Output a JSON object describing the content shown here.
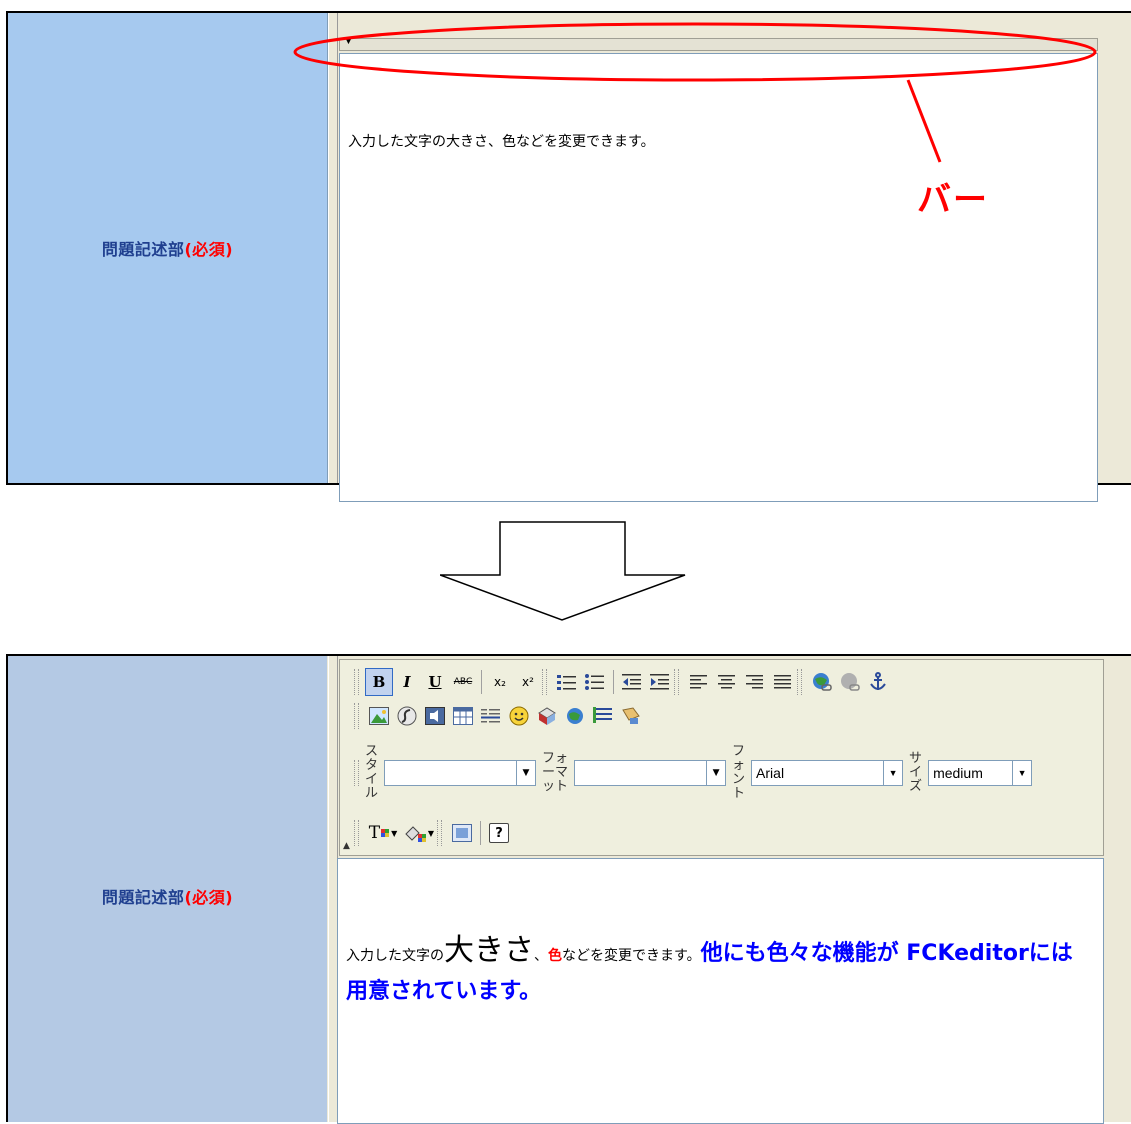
{
  "top_panel": {
    "field_label": "問題記述部",
    "field_required": "(必須)",
    "editor_text": "入力した文字の大きさ、色などを変更できます。",
    "bar_toggle": "▼",
    "callout_label": "バー"
  },
  "bottom_panel": {
    "field_label": "問題記述部",
    "field_required": "(必須)",
    "toolbar": {
      "bold": "B",
      "italic": "I",
      "underline": "U",
      "strike": "ABC",
      "subscript": "x₂",
      "superscript": "x²",
      "style_label": [
        "ス",
        "タ",
        "イ",
        "ル"
      ],
      "style_value": "",
      "format_label": [
        "フォ",
        "ーマ",
        "ット"
      ],
      "format_value": "",
      "font_label": [
        "フ",
        "ォ",
        "ン",
        "ト"
      ],
      "font_value": "Arial",
      "size_label": [
        "サ",
        "イ",
        "ズ"
      ],
      "size_value": "medium",
      "text_color": "T",
      "help": "?"
    },
    "editor_text": {
      "part1": "入力した文字の",
      "part2": "大きさ",
      "part3": "、",
      "part4": "色",
      "part5": "などを変更できます。",
      "part6": "他にも色々な機能が FCKeditorには用意されています。"
    }
  },
  "colors": {
    "label_bg_top": "#a6c9ef",
    "label_bg_bottom": "#b4c9e4",
    "required": "#ff0000",
    "callout": "#ff0000",
    "blue_text": "#0000ff"
  },
  "icons": [
    "bold-icon",
    "italic-icon",
    "underline-icon",
    "strikethrough-icon",
    "subscript-icon",
    "superscript-icon",
    "ordered-list-icon",
    "unordered-list-icon",
    "outdent-icon",
    "indent-icon",
    "align-left-icon",
    "align-center-icon",
    "align-right-icon",
    "justify-icon",
    "link-icon",
    "unlink-icon",
    "anchor-icon",
    "image-icon",
    "flash-icon",
    "media-icon",
    "table-icon",
    "horizontal-rule-icon",
    "smiley-icon",
    "special-char-icon",
    "page-break-icon",
    "form-icon",
    "text-color-icon",
    "bg-color-icon",
    "show-blocks-icon",
    "about-icon"
  ]
}
